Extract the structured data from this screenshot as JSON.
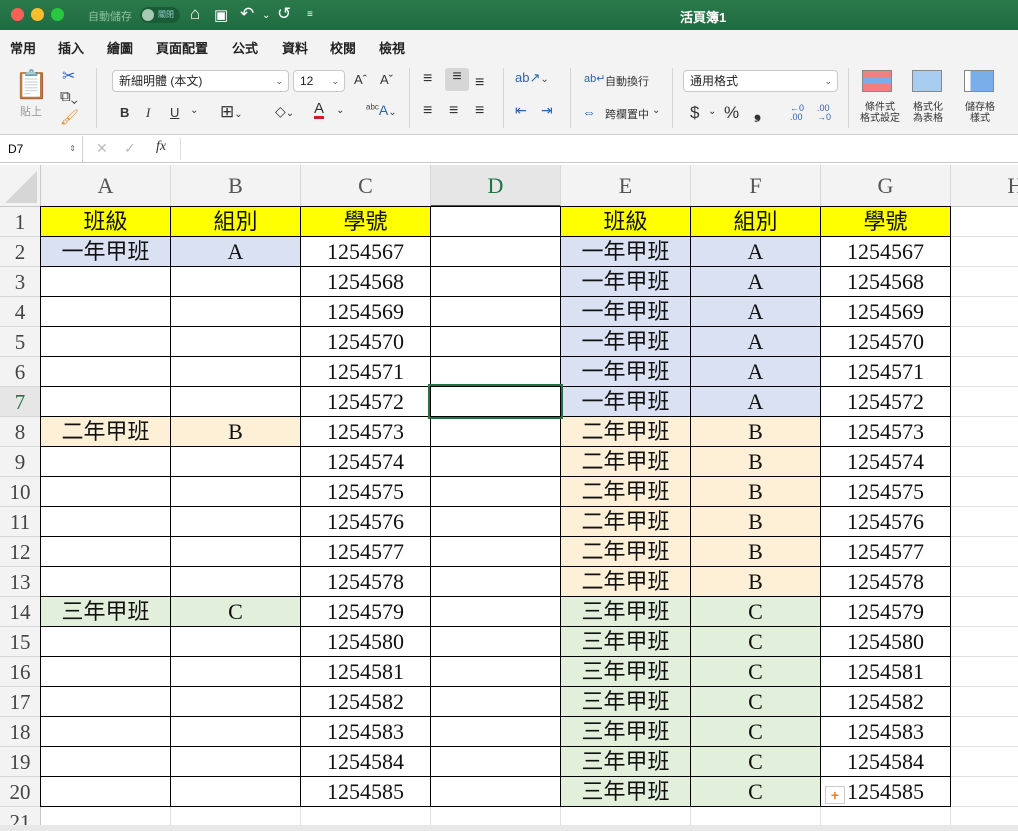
{
  "window": {
    "title": "活頁簿1",
    "autosave_label": "自動儲存",
    "autosave_toggle": "關閉"
  },
  "tabs": [
    "常用",
    "插入",
    "繪圖",
    "頁面配置",
    "公式",
    "資料",
    "校閱",
    "檢視"
  ],
  "ribbon": {
    "paste": "貼上",
    "font_name": "新細明體 (本文)",
    "font_size": "12",
    "bold": "B",
    "italic": "I",
    "underline": "U",
    "wrap_text": "自動換行",
    "merge_center": "跨欄置中",
    "number_format": "通用格式",
    "currency": "$",
    "percent": "%",
    "comma": "❟",
    "cond_format": [
      "條件式",
      "格式設定"
    ],
    "format_table": [
      "格式化",
      "為表格"
    ],
    "cell_styles": [
      "儲存格",
      "樣式"
    ]
  },
  "formula_bar": {
    "name_box": "D7",
    "fx": "fx",
    "value": ""
  },
  "columns": [
    "A",
    "B",
    "C",
    "D",
    "E",
    "F",
    "G",
    "H"
  ],
  "active_cell": {
    "col": "D",
    "row": 7
  },
  "colors": {
    "y": "#ffff00",
    "b": "#d9e1f2",
    "o": "#fdf0d6",
    "g": "#e2efda",
    "accent": "#217346"
  },
  "rows": [
    {
      "n": "1",
      "cells": [
        "班級",
        "組別",
        "學號",
        "",
        "班級",
        "組別",
        "學號",
        ""
      ],
      "fill": "yyy-yyy-"
    },
    {
      "n": "2",
      "cells": [
        "一年甲班",
        "A",
        "1254567",
        "",
        "一年甲班",
        "A",
        "1254567",
        ""
      ],
      "fill": "bb--bb--"
    },
    {
      "n": "3",
      "cells": [
        "",
        "",
        "1254568",
        "",
        "一年甲班",
        "A",
        "1254568",
        ""
      ],
      "fill": "----bb--"
    },
    {
      "n": "4",
      "cells": [
        "",
        "",
        "1254569",
        "",
        "一年甲班",
        "A",
        "1254569",
        ""
      ],
      "fill": "----bb--"
    },
    {
      "n": "5",
      "cells": [
        "",
        "",
        "1254570",
        "",
        "一年甲班",
        "A",
        "1254570",
        ""
      ],
      "fill": "----bb--"
    },
    {
      "n": "6",
      "cells": [
        "",
        "",
        "1254571",
        "",
        "一年甲班",
        "A",
        "1254571",
        ""
      ],
      "fill": "----bb--"
    },
    {
      "n": "7",
      "cells": [
        "",
        "",
        "1254572",
        "",
        "一年甲班",
        "A",
        "1254572",
        ""
      ],
      "fill": "----bb--"
    },
    {
      "n": "8",
      "cells": [
        "二年甲班",
        "B",
        "1254573",
        "",
        "二年甲班",
        "B",
        "1254573",
        ""
      ],
      "fill": "oo--oo--"
    },
    {
      "n": "9",
      "cells": [
        "",
        "",
        "1254574",
        "",
        "二年甲班",
        "B",
        "1254574",
        ""
      ],
      "fill": "----oo--"
    },
    {
      "n": "10",
      "cells": [
        "",
        "",
        "1254575",
        "",
        "二年甲班",
        "B",
        "1254575",
        ""
      ],
      "fill": "----oo--"
    },
    {
      "n": "11",
      "cells": [
        "",
        "",
        "1254576",
        "",
        "二年甲班",
        "B",
        "1254576",
        ""
      ],
      "fill": "----oo--"
    },
    {
      "n": "12",
      "cells": [
        "",
        "",
        "1254577",
        "",
        "二年甲班",
        "B",
        "1254577",
        ""
      ],
      "fill": "----oo--"
    },
    {
      "n": "13",
      "cells": [
        "",
        "",
        "1254578",
        "",
        "二年甲班",
        "B",
        "1254578",
        ""
      ],
      "fill": "----oo--"
    },
    {
      "n": "14",
      "cells": [
        "三年甲班",
        "C",
        "1254579",
        "",
        "三年甲班",
        "C",
        "1254579",
        ""
      ],
      "fill": "gg--gg--"
    },
    {
      "n": "15",
      "cells": [
        "",
        "",
        "1254580",
        "",
        "三年甲班",
        "C",
        "1254580",
        ""
      ],
      "fill": "----gg--"
    },
    {
      "n": "16",
      "cells": [
        "",
        "",
        "1254581",
        "",
        "三年甲班",
        "C",
        "1254581",
        ""
      ],
      "fill": "----gg--"
    },
    {
      "n": "17",
      "cells": [
        "",
        "",
        "1254582",
        "",
        "三年甲班",
        "C",
        "1254582",
        ""
      ],
      "fill": "----gg--"
    },
    {
      "n": "18",
      "cells": [
        "",
        "",
        "1254583",
        "",
        "三年甲班",
        "C",
        "1254583",
        ""
      ],
      "fill": "----gg--"
    },
    {
      "n": "19",
      "cells": [
        "",
        "",
        "1254584",
        "",
        "三年甲班",
        "C",
        "1254584",
        ""
      ],
      "fill": "----gg--"
    },
    {
      "n": "20",
      "cells": [
        "",
        "",
        "1254585",
        "",
        "三年甲班",
        "C",
        "1254585",
        ""
      ],
      "fill": "----gg--"
    },
    {
      "n": "21",
      "cells": [
        "",
        "",
        "",
        "",
        "",
        "",
        "",
        ""
      ],
      "fill": "--------"
    }
  ]
}
